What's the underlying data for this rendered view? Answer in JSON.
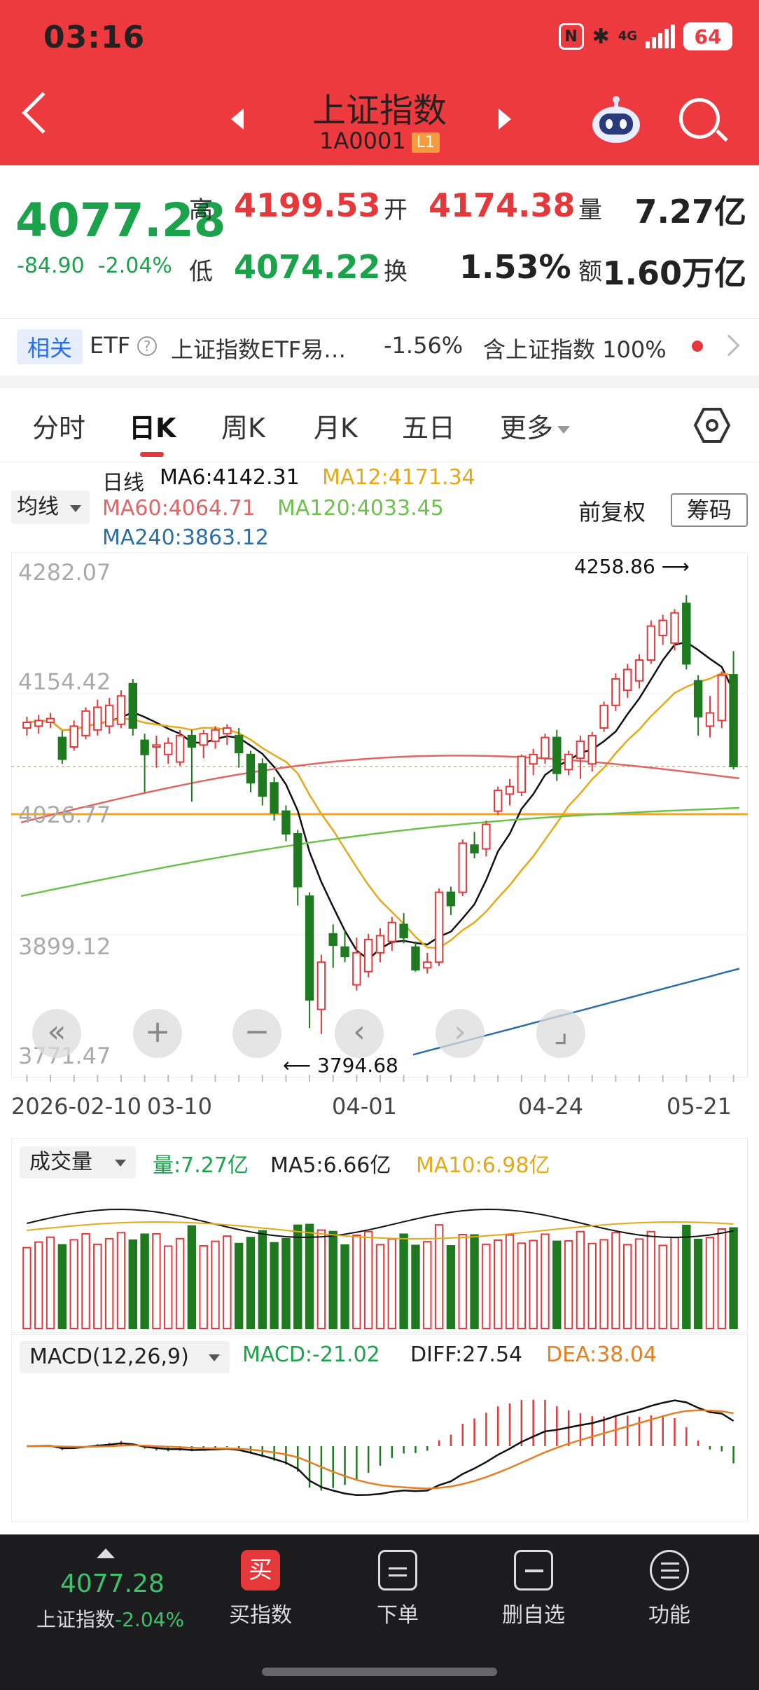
{
  "status_bar": {
    "time": "03:16",
    "network": "4G",
    "battery": "64"
  },
  "header": {
    "title": "上证指数",
    "code": "1A0001",
    "badge": "L1"
  },
  "quote": {
    "price": "4077.28",
    "change": "-84.90",
    "change_pct": "-2.04%",
    "high_label": "高",
    "high": "4199.53",
    "open_label": "开",
    "open": "4174.38",
    "volume_label": "量",
    "volume": "7.27亿",
    "low_label": "低",
    "low": "4074.22",
    "turnover_label": "换",
    "turnover": "1.53%",
    "amount_label": "额",
    "amount": "1.60万亿"
  },
  "related": {
    "tag": "相关",
    "etf_label": "ETF",
    "help": "?",
    "etf_name": "上证指数ETF易…",
    "etf_change": "-1.56%",
    "holding": "含上证指数 100%"
  },
  "tabs": [
    "分时",
    "日K",
    "周K",
    "月K",
    "五日",
    "更多"
  ],
  "ma_legend": {
    "period": "日线",
    "ma6": "MA6:4142.31",
    "ma12": "MA12:4171.34",
    "ma60": "MA60:4064.71",
    "ma120": "MA120:4033.45",
    "ma240": "MA240:3863.12",
    "dropdown": "均线",
    "adjust": "前复权",
    "chips": "筹码"
  },
  "main_chart": {
    "y_labels": [
      "4282.07",
      "4154.42",
      "4026.77",
      "3899.12",
      "3771.47"
    ],
    "max_annotation": "4258.86 ⟶",
    "min_annotation": "⟵ 3794.68",
    "dates": [
      "2026-02-10",
      "03-10",
      "04-01",
      "04-24",
      "05-21"
    ],
    "zoom_buttons": [
      "«",
      "+",
      "−",
      "‹",
      "›",
      "⌟"
    ]
  },
  "volume": {
    "dropdown": "成交量",
    "vol": "量:7.27亿",
    "ma5": "MA5:6.66亿",
    "ma10": "MA10:6.98亿"
  },
  "macd": {
    "dropdown": "MACD(12,26,9)",
    "macd": "MACD:-21.02",
    "diff": "DIFF:27.54",
    "dea": "DEA:38.04"
  },
  "bottom_bar": {
    "price": "4077.28",
    "name": "上证指数",
    "pct": "-2.04%",
    "buy_icon": "买",
    "items": [
      "买指数",
      "下单",
      "删自选",
      "功能"
    ]
  },
  "colors": {
    "up": "#e5383b",
    "down": "#1f7a1f",
    "header": "#ec3a3f",
    "ma6": "#111111",
    "ma12": "#e6a817",
    "ma60": "#e06666",
    "ma120": "#6cc24a",
    "ma240": "#2a6ea8"
  },
  "chart_data": {
    "type": "candlestick",
    "ylim": [
      3771.47,
      4282.07
    ],
    "candles": [
      {
        "o": 4118,
        "h": 4130,
        "l": 4110,
        "c": 4124
      },
      {
        "o": 4120,
        "h": 4132,
        "l": 4112,
        "c": 4126
      },
      {
        "o": 4124,
        "h": 4134,
        "l": 4118,
        "c": 4128
      },
      {
        "o": 4108,
        "h": 4115,
        "l": 4080,
        "c": 4085
      },
      {
        "o": 4098,
        "h": 4126,
        "l": 4094,
        "c": 4120
      },
      {
        "o": 4110,
        "h": 4140,
        "l": 4106,
        "c": 4136
      },
      {
        "o": 4116,
        "h": 4148,
        "l": 4110,
        "c": 4140
      },
      {
        "o": 4120,
        "h": 4150,
        "l": 4112,
        "c": 4142
      },
      {
        "o": 4122,
        "h": 4158,
        "l": 4118,
        "c": 4152
      },
      {
        "o": 4165,
        "h": 4170,
        "l": 4110,
        "c": 4118
      },
      {
        "o": 4105,
        "h": 4112,
        "l": 4050,
        "c": 4090
      },
      {
        "o": 4098,
        "h": 4110,
        "l": 4076,
        "c": 4100
      },
      {
        "o": 4090,
        "h": 4108,
        "l": 4080,
        "c": 4102
      },
      {
        "o": 4082,
        "h": 4116,
        "l": 4078,
        "c": 4110
      },
      {
        "o": 4110,
        "h": 4116,
        "l": 4040,
        "c": 4098
      },
      {
        "o": 4100,
        "h": 4116,
        "l": 4086,
        "c": 4112
      },
      {
        "o": 4104,
        "h": 4120,
        "l": 4096,
        "c": 4116
      },
      {
        "o": 4112,
        "h": 4122,
        "l": 4100,
        "c": 4118
      },
      {
        "o": 4110,
        "h": 4118,
        "l": 4076,
        "c": 4092
      },
      {
        "o": 4090,
        "h": 4094,
        "l": 4050,
        "c": 4060
      },
      {
        "o": 4080,
        "h": 4086,
        "l": 4036,
        "c": 4046
      },
      {
        "o": 4060,
        "h": 4066,
        "l": 4020,
        "c": 4028
      },
      {
        "o": 4030,
        "h": 4036,
        "l": 3998,
        "c": 4006
      },
      {
        "o": 4006,
        "h": 4010,
        "l": 3930,
        "c": 3950
      },
      {
        "o": 3940,
        "h": 3944,
        "l": 3800,
        "c": 3830
      },
      {
        "o": 3820,
        "h": 3878,
        "l": 3794,
        "c": 3870
      },
      {
        "o": 3900,
        "h": 3910,
        "l": 3864,
        "c": 3888
      },
      {
        "o": 3886,
        "h": 3904,
        "l": 3870,
        "c": 3876
      },
      {
        "o": 3846,
        "h": 3896,
        "l": 3840,
        "c": 3880
      },
      {
        "o": 3860,
        "h": 3900,
        "l": 3854,
        "c": 3894
      },
      {
        "o": 3880,
        "h": 3906,
        "l": 3870,
        "c": 3898
      },
      {
        "o": 3892,
        "h": 3918,
        "l": 3882,
        "c": 3912
      },
      {
        "o": 3910,
        "h": 3922,
        "l": 3890,
        "c": 3896
      },
      {
        "o": 3886,
        "h": 3892,
        "l": 3860,
        "c": 3862
      },
      {
        "o": 3864,
        "h": 3880,
        "l": 3858,
        "c": 3870
      },
      {
        "o": 3870,
        "h": 3948,
        "l": 3866,
        "c": 3944
      },
      {
        "o": 3944,
        "h": 3950,
        "l": 3920,
        "c": 3930
      },
      {
        "o": 3944,
        "h": 4000,
        "l": 3940,
        "c": 3996
      },
      {
        "o": 3994,
        "h": 4008,
        "l": 3980,
        "c": 3986
      },
      {
        "o": 3990,
        "h": 4020,
        "l": 3982,
        "c": 4016
      },
      {
        "o": 4030,
        "h": 4056,
        "l": 4026,
        "c": 4052
      },
      {
        "o": 4048,
        "h": 4064,
        "l": 4036,
        "c": 4056
      },
      {
        "o": 4050,
        "h": 4090,
        "l": 4046,
        "c": 4088
      },
      {
        "o": 4080,
        "h": 4096,
        "l": 4068,
        "c": 4090
      },
      {
        "o": 4086,
        "h": 4112,
        "l": 4080,
        "c": 4108
      },
      {
        "o": 4108,
        "h": 4116,
        "l": 4062,
        "c": 4070
      },
      {
        "o": 4074,
        "h": 4094,
        "l": 4068,
        "c": 4090
      },
      {
        "o": 4086,
        "h": 4110,
        "l": 4064,
        "c": 4104
      },
      {
        "o": 4080,
        "h": 4114,
        "l": 4072,
        "c": 4110
      },
      {
        "o": 4118,
        "h": 4146,
        "l": 4114,
        "c": 4142
      },
      {
        "o": 4142,
        "h": 4176,
        "l": 4136,
        "c": 4170
      },
      {
        "o": 4158,
        "h": 4186,
        "l": 4150,
        "c": 4180
      },
      {
        "o": 4168,
        "h": 4196,
        "l": 4160,
        "c": 4190
      },
      {
        "o": 4190,
        "h": 4232,
        "l": 4186,
        "c": 4226
      },
      {
        "o": 4216,
        "h": 4238,
        "l": 4206,
        "c": 4232
      },
      {
        "o": 4208,
        "h": 4244,
        "l": 4200,
        "c": 4240
      },
      {
        "o": 4250,
        "h": 4258.86,
        "l": 4180,
        "c": 4186
      },
      {
        "o": 4168,
        "h": 4174,
        "l": 4110,
        "c": 4130
      },
      {
        "o": 4120,
        "h": 4152,
        "l": 4108,
        "c": 4134
      },
      {
        "o": 4126,
        "h": 4178,
        "l": 4118,
        "c": 4174
      },
      {
        "o": 4174.38,
        "h": 4199.53,
        "l": 4074.22,
        "c": 4077.28
      }
    ]
  }
}
